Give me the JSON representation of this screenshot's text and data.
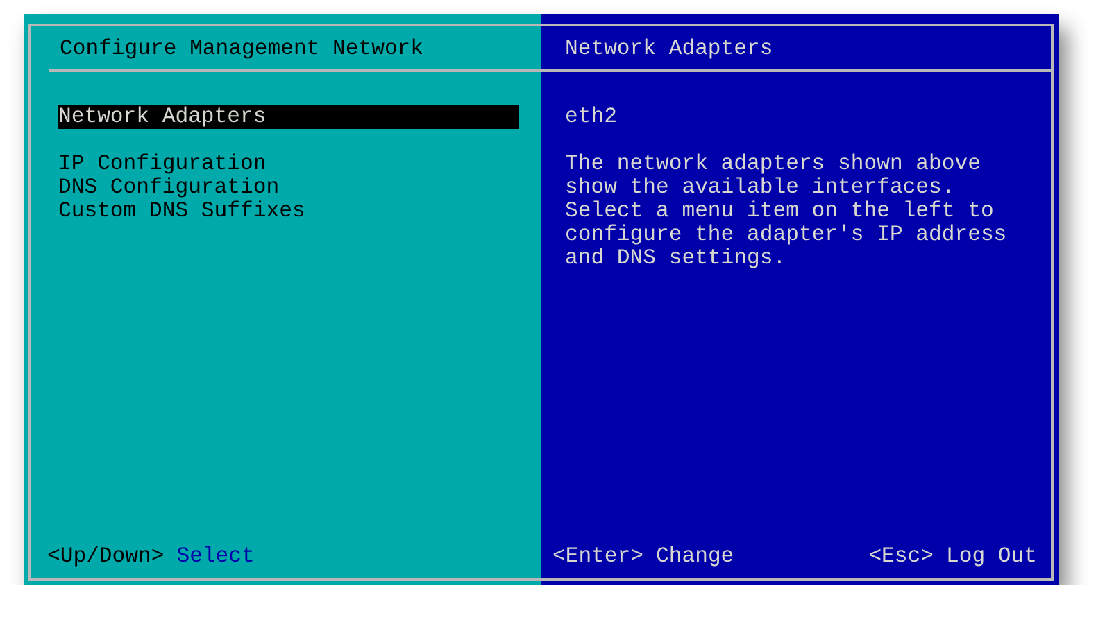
{
  "left_panel": {
    "title": "Configure Management Network",
    "menu_groups": [
      [
        {
          "label": "Network Adapters",
          "selected": true
        }
      ],
      [
        {
          "label": "IP Configuration",
          "selected": false
        },
        {
          "label": "DNS Configuration",
          "selected": false
        },
        {
          "label": "Custom DNS Suffixes",
          "selected": false
        }
      ]
    ],
    "footer": [
      {
        "key": "<Up/Down>",
        "action": "Select"
      }
    ]
  },
  "right_panel": {
    "title": "Network Adapters",
    "adapter": "eth2",
    "description": "The network adapters shown above show the available interfaces. Select a menu item on the left to configure the adapter's IP address and DNS settings.",
    "footer": [
      {
        "key": "<Enter>",
        "action": "Change"
      },
      {
        "key": "<Esc>",
        "action": "Log Out"
      }
    ]
  }
}
